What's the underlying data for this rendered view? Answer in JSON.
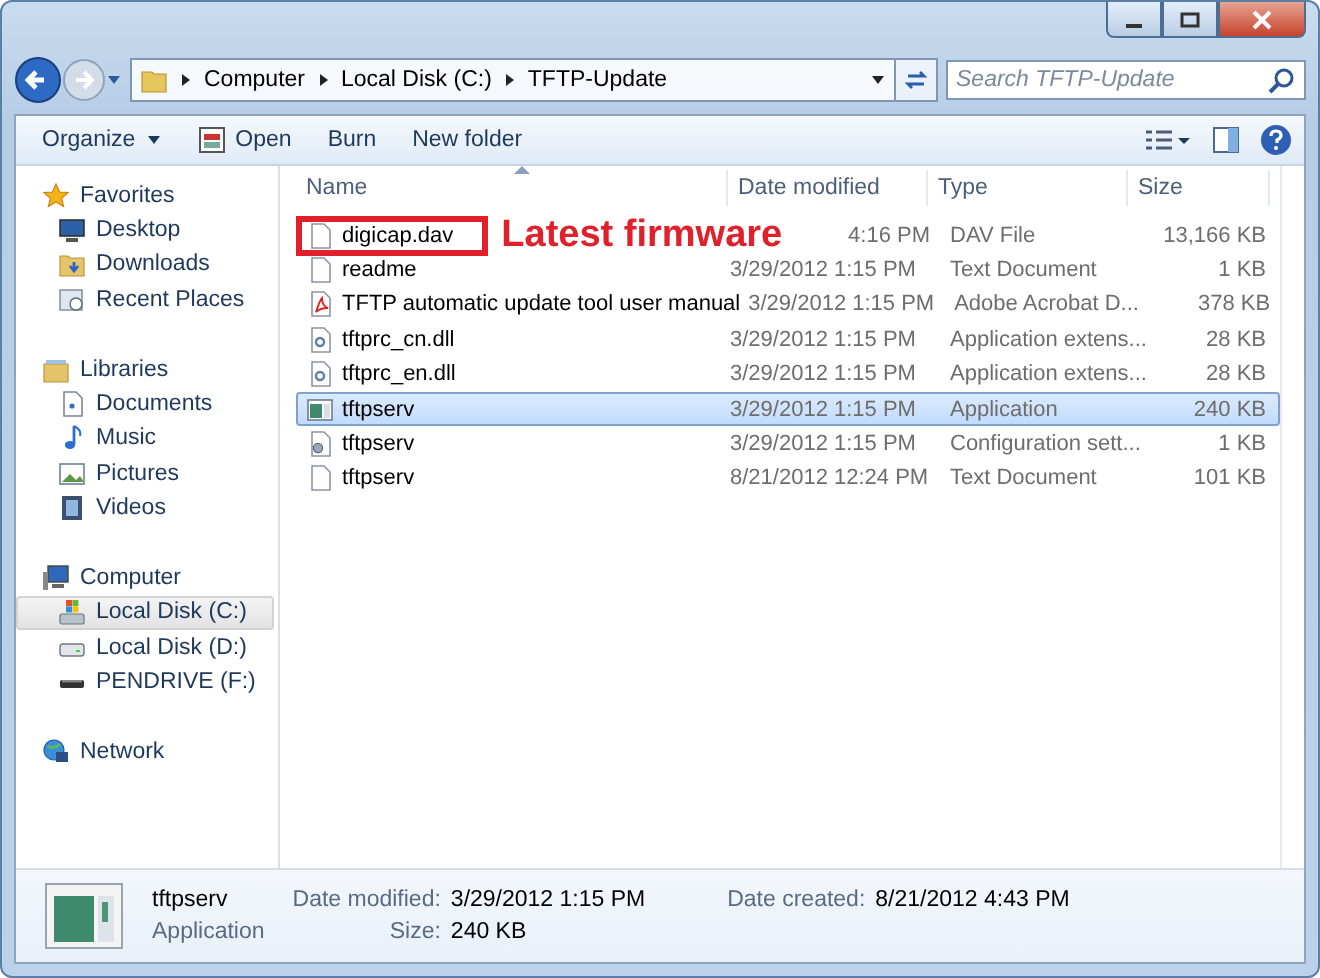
{
  "address_bar": {
    "segments": [
      "Computer",
      "Local Disk (C:)",
      "TFTP-Update"
    ]
  },
  "search": {
    "placeholder": "Search TFTP-Update"
  },
  "toolbar": {
    "buttons": [
      {
        "label": "Organize",
        "kind": "menu"
      },
      {
        "label": "Open",
        "kind": "icon"
      },
      {
        "label": "Burn",
        "kind": "plain"
      },
      {
        "label": "New folder",
        "kind": "plain"
      }
    ]
  },
  "sidebar": {
    "sections": [
      {
        "label": "Favorites",
        "kind": "star",
        "children": [
          {
            "label": "Desktop",
            "kind": "desktop",
            "selected": false
          },
          {
            "label": "Downloads",
            "kind": "downloads",
            "selected": false
          },
          {
            "label": "Recent Places",
            "kind": "recent",
            "selected": false
          }
        ]
      },
      {
        "label": "Libraries",
        "kind": "library",
        "children": [
          {
            "label": "Documents",
            "kind": "document",
            "selected": false
          },
          {
            "label": "Music",
            "kind": "music",
            "selected": false
          },
          {
            "label": "Pictures",
            "kind": "picture",
            "selected": false
          },
          {
            "label": "Videos",
            "kind": "video",
            "selected": false
          }
        ]
      },
      {
        "label": "Computer",
        "kind": "computer",
        "children": [
          {
            "label": "Local Disk (C:)",
            "kind": "system-disk",
            "selected": true
          },
          {
            "label": "Local Disk (D:)",
            "kind": "disk",
            "selected": false
          },
          {
            "label": "PENDRIVE (F:)",
            "kind": "usb",
            "selected": false
          }
        ]
      },
      {
        "label": "Network",
        "kind": "network"
      }
    ]
  },
  "table": {
    "columns": [
      "Name",
      "Date modified",
      "Type",
      "Size"
    ],
    "rows": [
      {
        "name": "digicap.dav",
        "kind": "text",
        "date": "4:16 PM",
        "type": "DAV File",
        "size": "13,166 KB",
        "selected": false,
        "highlighted": true,
        "annotation": "Latest firmware"
      },
      {
        "name": "readme",
        "kind": "text",
        "date": "3/29/2012 1:15 PM",
        "type": "Text Document",
        "size": "1 KB",
        "selected": false,
        "highlighted": false
      },
      {
        "name": "TFTP automatic update tool user manual",
        "kind": "pdf",
        "date": "3/29/2012 1:15 PM",
        "type": "Adobe Acrobat D...",
        "size": "378 KB",
        "selected": false,
        "highlighted": false
      },
      {
        "name": "tftprc_cn.dll",
        "kind": "dll",
        "date": "3/29/2012 1:15 PM",
        "type": "Application extens...",
        "size": "28 KB",
        "selected": false,
        "highlighted": false
      },
      {
        "name": "tftprc_en.dll",
        "kind": "dll",
        "date": "3/29/2012 1:15 PM",
        "type": "Application extens...",
        "size": "28 KB",
        "selected": false,
        "highlighted": false
      },
      {
        "name": "tftpserv",
        "kind": "app",
        "date": "3/29/2012 1:15 PM",
        "type": "Application",
        "size": "240 KB",
        "selected": true,
        "highlighted": false
      },
      {
        "name": "tftpserv",
        "kind": "config",
        "date": "3/29/2012 1:15 PM",
        "type": "Configuration sett...",
        "size": "1 KB",
        "selected": false,
        "highlighted": false
      },
      {
        "name": "tftpserv",
        "kind": "text",
        "date": "8/21/2012 12:24 PM",
        "type": "Text Document",
        "size": "101 KB",
        "selected": false,
        "highlighted": false
      }
    ]
  },
  "details": {
    "name": "tftpserv",
    "type": "Application",
    "fields": [
      {
        "label": "Date modified:",
        "value": "3/29/2012 1:15 PM"
      },
      {
        "label": "Size:",
        "value": "240 KB"
      },
      {
        "label": "Date created:",
        "value": "8/21/2012 4:43 PM"
      }
    ]
  }
}
